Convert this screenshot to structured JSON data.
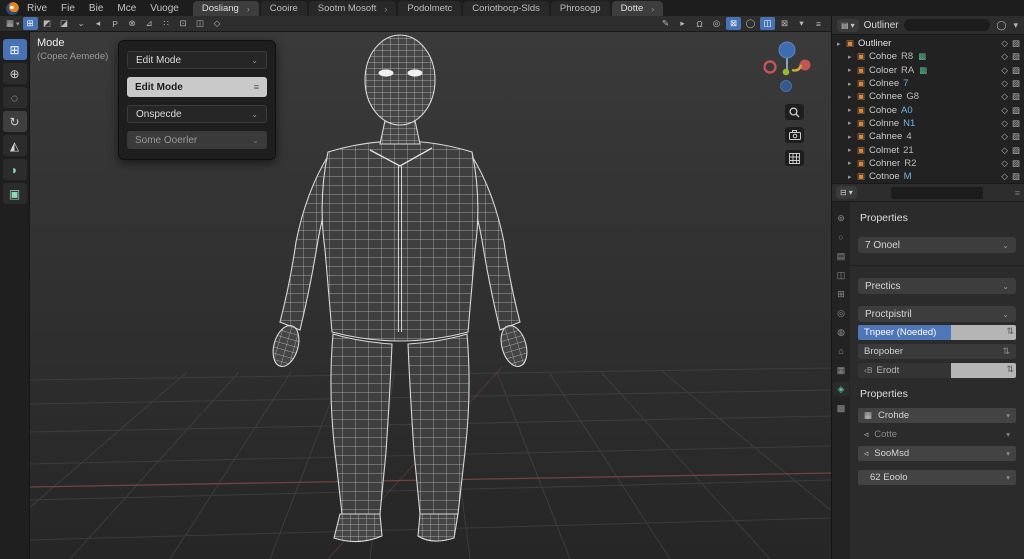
{
  "colors": {
    "accent_blue": "#4772b3",
    "selection_blue": "#4f76b8",
    "collection_orange": "#d9883d",
    "link_green": "#55b88a",
    "data_blue_text": "#6fb7e8",
    "axis_red": "#7c4444",
    "active_tab_teal": "#4fc1a1"
  },
  "menubar": {
    "menus": [
      "Rive",
      "Fie",
      "Bie",
      "Mce",
      "Vuoge"
    ],
    "tabs": [
      {
        "label": "Dosliang",
        "arrow": "›",
        "active": true
      },
      {
        "label": "Cooire"
      },
      {
        "label": "Sootm Mosoft",
        "arrow": "›"
      },
      {
        "label": "Podolmetc"
      },
      {
        "label": "Coriotbocp-Slds"
      },
      {
        "label": "Phrosogp"
      },
      {
        "label": "Dotte",
        "arrow": "›",
        "active": true
      }
    ]
  },
  "viewport_header": {
    "left_icons": [
      {
        "glyph": "▦",
        "name": "editor-type-icon",
        "dropdown": true
      },
      {
        "glyph": "⊞",
        "name": "mode-select-icon",
        "active": true
      },
      {
        "glyph": "◩",
        "name": "select-mode-vertex-icon"
      },
      {
        "glyph": "◪",
        "name": "select-mode-edge-icon"
      },
      {
        "glyph": "⌄",
        "name": "view-menu-icon"
      },
      {
        "glyph": "◂",
        "name": "select-menu-icon"
      },
      {
        "glyph": "P",
        "name": "add-menu-icon"
      },
      {
        "glyph": "⊗",
        "name": "mesh-menu-icon"
      },
      {
        "glyph": "⊿",
        "name": "transform-orientation-icon"
      },
      {
        "glyph": "∷",
        "name": "snap-icon"
      },
      {
        "glyph": "⊡",
        "name": "proportional-editing-icon"
      },
      {
        "glyph": "◫",
        "name": "pivot-point-icon"
      },
      {
        "glyph": "◇",
        "name": "options-icon"
      }
    ],
    "right_icons": [
      {
        "glyph": "✎",
        "name": "tool-settings-icon"
      },
      {
        "glyph": "▸",
        "name": "expand-icon"
      },
      {
        "glyph": "Ω",
        "name": "snap-magnet-icon"
      },
      {
        "glyph": "◎",
        "name": "proportional-edit-icon"
      },
      {
        "glyph": "⊠",
        "name": "xray-toggle-icon",
        "active": true
      },
      {
        "glyph": "◯",
        "name": "shading-wireframe-icon"
      },
      {
        "glyph": "◫",
        "name": "shading-solid-icon",
        "active": true
      },
      {
        "glyph": "⊠",
        "name": "shading-material-icon"
      },
      {
        "glyph": "▾",
        "name": "shading-dropdown-icon"
      },
      {
        "glyph": "≡",
        "name": "overlays-icon"
      }
    ]
  },
  "toolbar": {
    "tools": [
      {
        "glyph": "⊞",
        "name": "tweak-select-tool",
        "active": true
      },
      {
        "glyph": "⊕",
        "name": "cursor-tool"
      },
      {
        "glyph": "◌",
        "name": "lasso-select-tool"
      },
      {
        "glyph": "↻",
        "name": "rotate-tool",
        "semi": true
      },
      {
        "glyph": "◭",
        "name": "knife-tool"
      },
      {
        "glyph": "◗",
        "name": "spin-tool",
        "green": true
      },
      {
        "glyph": "▣",
        "name": "measure-tool",
        "green": true
      }
    ]
  },
  "mode_panel": {
    "title": "Mode",
    "subtitle": "(Copec Aemede)",
    "rows": [
      {
        "label": "Edit Mode",
        "type": "dropdown"
      },
      {
        "label": "Edit Mode",
        "type": "selected"
      },
      {
        "label": "Onspecde",
        "type": "dropdown"
      },
      {
        "label": "Some Ooerler",
        "type": "disabled"
      }
    ]
  },
  "outliner": {
    "title": "Outliner",
    "search_value": "",
    "rows": [
      {
        "label": "Outliner",
        "root": true
      },
      {
        "label": "Cohoe",
        "suffix": "R8",
        "extra_icon": true
      },
      {
        "label": "Coloer",
        "suffix": "RA",
        "extra_icon": true
      },
      {
        "label": "Colnee",
        "suffix": "7",
        "suffix_blue": true
      },
      {
        "label": "Cohnee",
        "suffix": "G8"
      },
      {
        "label": "Cohoe",
        "suffix": "A0",
        "suffix_blue": true
      },
      {
        "label": "Colnne",
        "suffix": "N1",
        "suffix_blue": true
      },
      {
        "label": "Cahnee",
        "suffix": "4"
      },
      {
        "label": "Colmet",
        "suffix": "21"
      },
      {
        "label": "Cohner",
        "suffix": "R2"
      },
      {
        "label": "Cotnoe",
        "suffix": "M",
        "suffix_blue": true
      }
    ]
  },
  "properties": {
    "search_value": "",
    "title": "Properties",
    "dropdown1": "7 Onoel",
    "dropdown2": "Prectics",
    "dropdown3": "Proctpistril",
    "selected_field": "Tnpeer (Noeded)",
    "field2": "Bropober",
    "subfield_prefix": "‹B",
    "subfield_label": "Erodt",
    "title2": "Properties",
    "tabs": [
      {
        "glyph": "⊚",
        "name": "tab-tool"
      },
      {
        "glyph": "○",
        "name": "tab-render"
      },
      {
        "glyph": "▤",
        "name": "tab-output"
      },
      {
        "glyph": "◫",
        "name": "tab-view-layer"
      },
      {
        "glyph": "⊞",
        "name": "tab-scene"
      },
      {
        "glyph": "◎",
        "name": "tab-world"
      },
      {
        "glyph": "◍",
        "name": "tab-object"
      },
      {
        "glyph": "⌂",
        "name": "tab-modifiers"
      },
      {
        "glyph": "▦",
        "name": "tab-particles"
      },
      {
        "glyph": "◈",
        "name": "tab-physics",
        "active": true
      },
      {
        "glyph": "▩",
        "name": "tab-constraints"
      }
    ],
    "buttons": [
      {
        "glyph": "▦",
        "label": "Crohde"
      },
      {
        "glyph": "◃",
        "label": "Cotte",
        "dim": true
      },
      {
        "glyph": "◃",
        "label": "SooMsd"
      },
      {
        "glyph": "",
        "label": "62 Eoolo",
        "last": true
      }
    ]
  }
}
